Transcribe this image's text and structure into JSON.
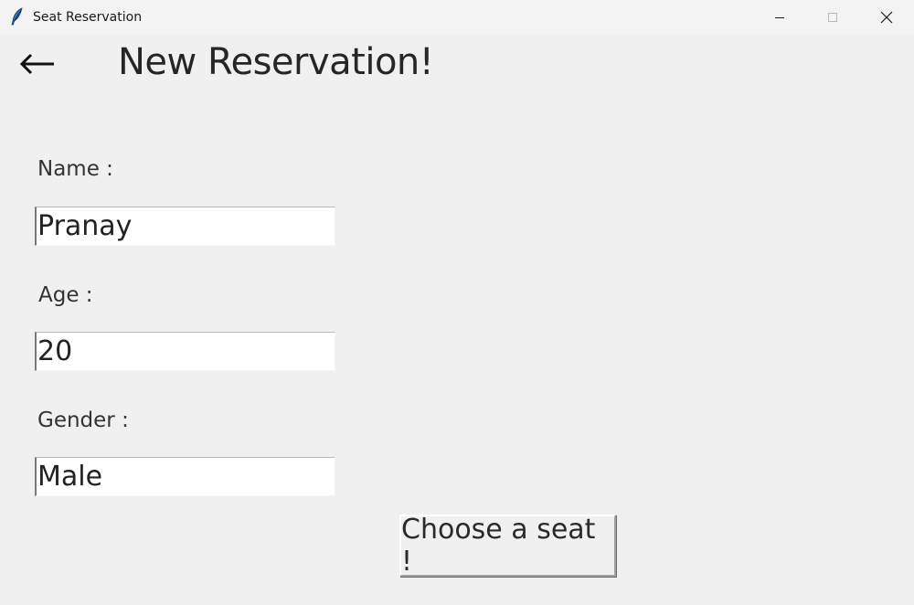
{
  "window": {
    "title": "Seat Reservation",
    "app_icon": "feather-icon",
    "controls": [
      "minimize-icon",
      "maximize-icon",
      "close-icon"
    ]
  },
  "header": {
    "back_icon": "arrow-left-icon",
    "back_glyph": "⟵",
    "title": "New Reservation!"
  },
  "form": {
    "name": {
      "label": "Name :",
      "value": "Pranay"
    },
    "age": {
      "label": "Age :",
      "value": "20"
    },
    "gender": {
      "label": "Gender :",
      "value": "Male"
    }
  },
  "actions": {
    "choose_seat_label": "Choose a seat !"
  },
  "colors": {
    "background": "#f0f0f0",
    "titlebar": "#f3f3f3",
    "input_bg": "#ffffff",
    "text": "#222222"
  }
}
